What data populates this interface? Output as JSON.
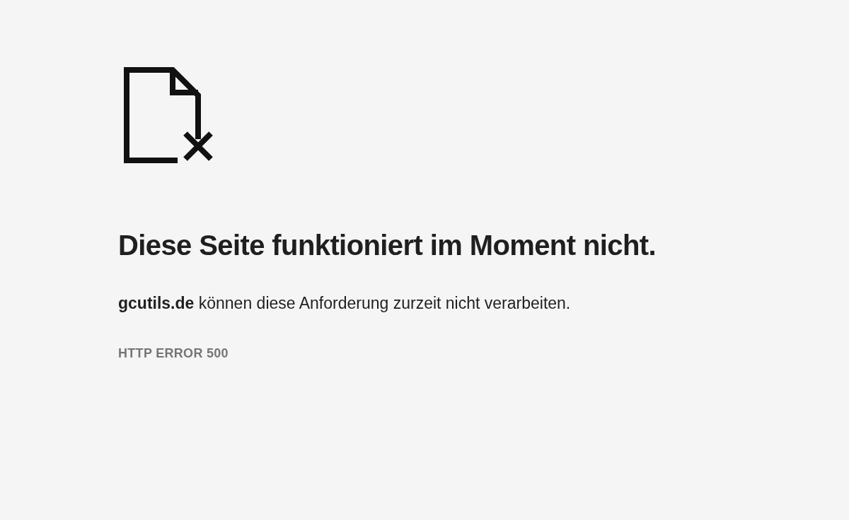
{
  "heading": "Diese Seite funktioniert im Moment nicht.",
  "message": "**gcutils.de** können diese Anforderung zurzeit nicht verarbeiten.",
  "error_code": "HTTP ERROR 500"
}
